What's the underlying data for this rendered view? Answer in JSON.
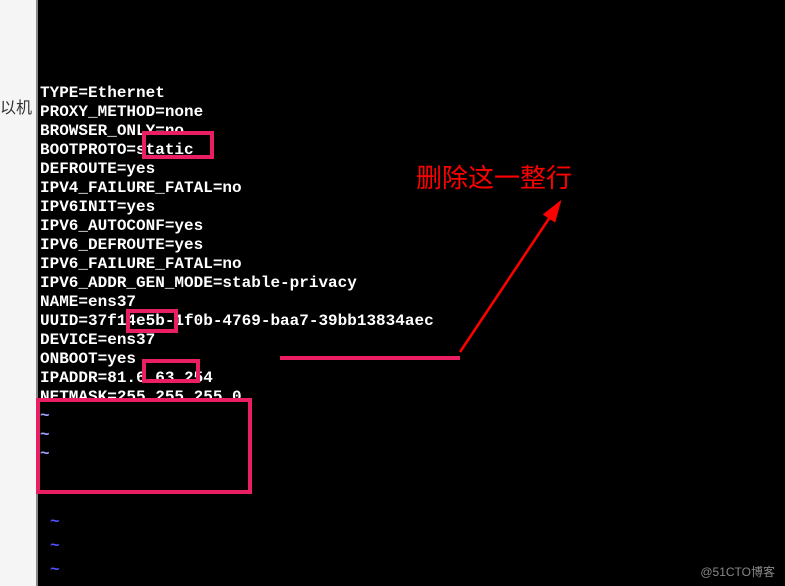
{
  "left_label": "以机",
  "config": {
    "line1": "TYPE=Ethernet",
    "line2": "PROXY_METHOD=none",
    "line3": "BROWSER_ONLY=no",
    "line4": "BOOTPROTO=static",
    "line5": "DEFROUTE=yes",
    "line6": "IPV4_FAILURE_FATAL=no",
    "line7": "IPV6INIT=yes",
    "line8": "IPV6_AUTOCONF=yes",
    "line9": "IPV6_DEFROUTE=yes",
    "line10": "IPV6_FAILURE_FATAL=no",
    "line11": "IPV6_ADDR_GEN_MODE=stable-privacy",
    "line12": "NAME=ens37",
    "line13": "UUID=37f14e5b-1f0b-4769-baa7-39bb13834aec",
    "line14": "DEVICE=ens37",
    "line15": "ONBOOT=yes",
    "line16": "IPADDR=81.6.63.254",
    "line17": "NETMASK=255.255.255.0"
  },
  "annotation": "删除这一整行",
  "watermark": "@51CTO博客",
  "tilde": "~"
}
